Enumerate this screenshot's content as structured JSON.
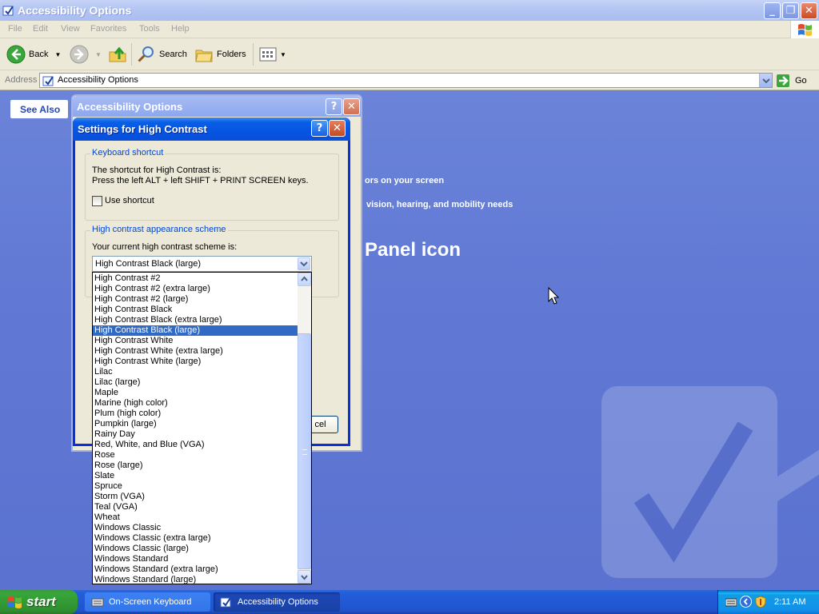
{
  "window": {
    "title": "Accessibility Options",
    "menu": [
      "File",
      "Edit",
      "View",
      "Favorites",
      "Tools",
      "Help"
    ],
    "toolbar": {
      "back": "Back",
      "search": "Search",
      "folders": "Folders"
    },
    "address": {
      "label": "Address",
      "value": "Accessibility Options",
      "go": "Go"
    }
  },
  "content": {
    "see_also": "See Also",
    "line1": "ors on your screen",
    "line2": "vision, hearing, and mobility needs",
    "heading": "Panel icon"
  },
  "back_dialog": {
    "title": "Accessibility Options"
  },
  "dialog": {
    "title": "Settings for High Contrast",
    "shortcut_group": "Keyboard shortcut",
    "shortcut_text1": "The shortcut for High Contrast is:",
    "shortcut_text2": "Press the left ALT + left SHIFT + PRINT SCREEN keys.",
    "use_shortcut": "Use shortcut",
    "scheme_group": "High contrast appearance scheme",
    "scheme_label": "Your current high contrast scheme is:",
    "scheme_value": "High Contrast Black (large)",
    "cancel_partial": "cel",
    "selected_index": 5,
    "schemes": [
      "High Contrast #2",
      "High Contrast #2 (extra large)",
      "High Contrast #2 (large)",
      "High Contrast Black",
      "High Contrast Black (extra large)",
      "High Contrast Black (large)",
      "High Contrast White",
      "High Contrast White (extra large)",
      "High Contrast White (large)",
      "Lilac",
      "Lilac (large)",
      "Maple",
      "Marine (high color)",
      "Plum (high color)",
      "Pumpkin (large)",
      "Rainy Day",
      "Red, White, and Blue (VGA)",
      "Rose",
      "Rose (large)",
      "Slate",
      "Spruce",
      "Storm (VGA)",
      "Teal (VGA)",
      "Wheat",
      "Windows Classic",
      "Windows Classic (extra large)",
      "Windows Classic (large)",
      "Windows Standard",
      "Windows Standard (extra large)",
      "Windows Standard (large)"
    ]
  },
  "taskbar": {
    "start": "start",
    "tasks": [
      "On-Screen Keyboard",
      "Accessibility Options"
    ],
    "clock": "2:11 AM"
  },
  "colors": {
    "selection": "#316ac5",
    "titlebar_active": "#0554e3",
    "content_bg": "#6179d4"
  }
}
